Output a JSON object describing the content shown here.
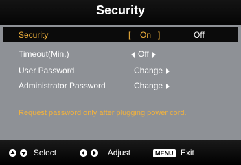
{
  "title": "Security",
  "menu": {
    "rows": [
      {
        "label": "Security",
        "value": "On",
        "bracket_left": "[",
        "bracket_right": "]",
        "alt": "Off"
      },
      {
        "label": "Timeout(Min.)",
        "value": "Off"
      },
      {
        "label": "User Password",
        "value": "Change"
      },
      {
        "label": "Administrator Password",
        "value": "Change"
      }
    ],
    "note": "Request password only after plugging power cord."
  },
  "footer": {
    "select": "Select",
    "adjust": "Adjust",
    "menu_key": "MENU",
    "exit": "Exit"
  },
  "colors": {
    "highlight": "#f2b23c",
    "panel": "#8e9196",
    "bar": "#000000"
  }
}
